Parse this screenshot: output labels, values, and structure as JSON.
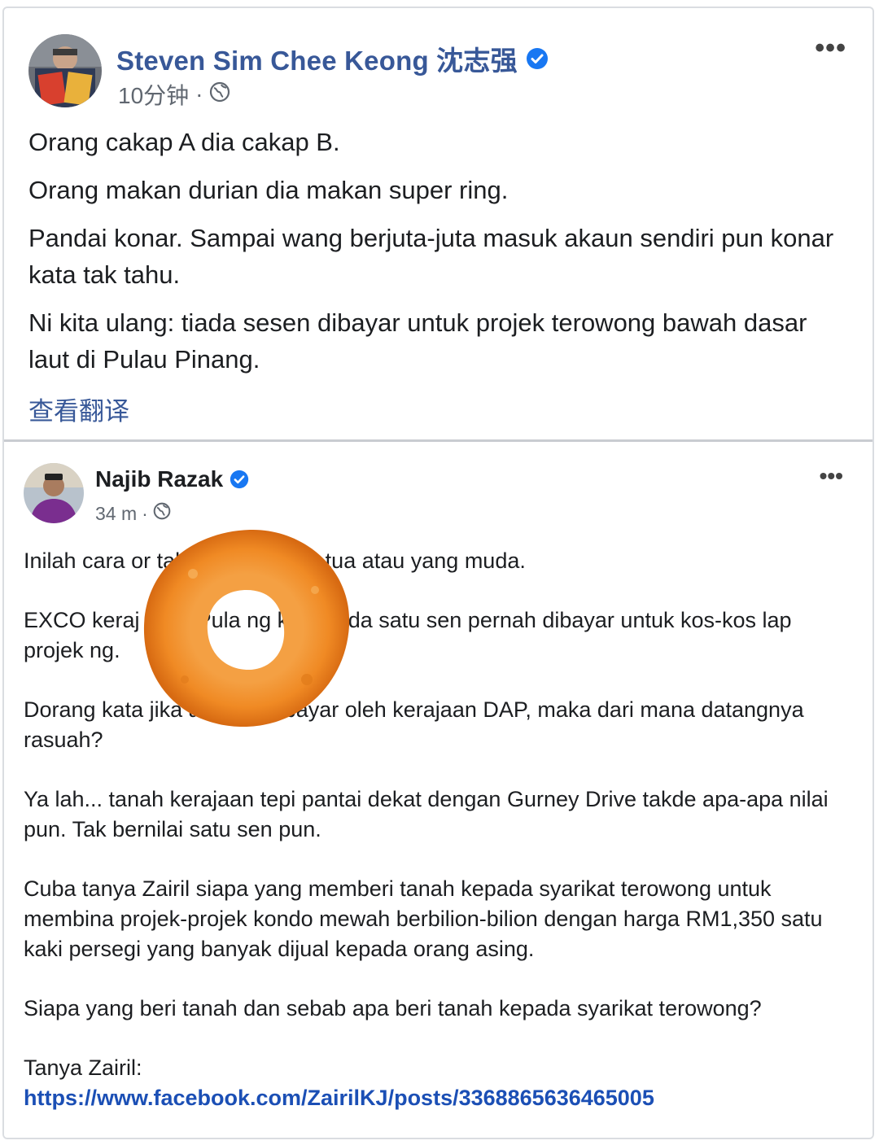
{
  "outer_post": {
    "author": "Steven Sim Chee Keong 沈志强",
    "time": "10分钟",
    "separator": "·",
    "paragraphs": [
      "Orang cakap A dia cakap B.",
      "Orang makan durian dia makan super ring.",
      "Pandai konar. Sampai wang berjuta-juta masuk akaun sendiri pun konar kata tak tahu.",
      "Ni kita ulang: tiada sesen dibayar untuk projek terowong bawah dasar laut di Pulau Pinang."
    ],
    "see_translation": "查看翻译",
    "more_label": "•••"
  },
  "shared_post": {
    "author": "Najib Razak",
    "time": "34 m",
    "separator": "·",
    "more_label": "•••",
    "paragraphs": [
      "Inilah cara or        tak kira yang tua-tua atau yang muda.",
      "EXCO keraj       DAP Pula       ng kata tiada satu sen pernah dibayar untuk kos-kos lap       projek        ng.",
      "Dorang kata jika        atu sen dibayar oleh kerajaan DAP, maka dari mana datangnya rasuah?",
      "Ya lah... tanah kerajaan tepi pantai dekat dengan Gurney Drive takde apa-apa nilai pun. Tak bernilai satu sen pun.",
      "Cuba tanya Zairil siapa yang memberi tanah kepada syarikat terowong untuk membina projek-projek kondo mewah berbilion-bilion dengan harga RM1,350 satu kaki persegi yang banyak dijual kepada orang asing.",
      "Siapa yang beri tanah dan sebab apa beri tanah kepada syarikat terowong?"
    ],
    "ask_label": "Tanya Zairil:",
    "link": "https://www.facebook.com/ZairilKJ/posts/3368865636465005"
  },
  "colors": {
    "link_blue": "#385898",
    "verified_blue": "#1877f2",
    "ring_orange": "#f08a24"
  }
}
